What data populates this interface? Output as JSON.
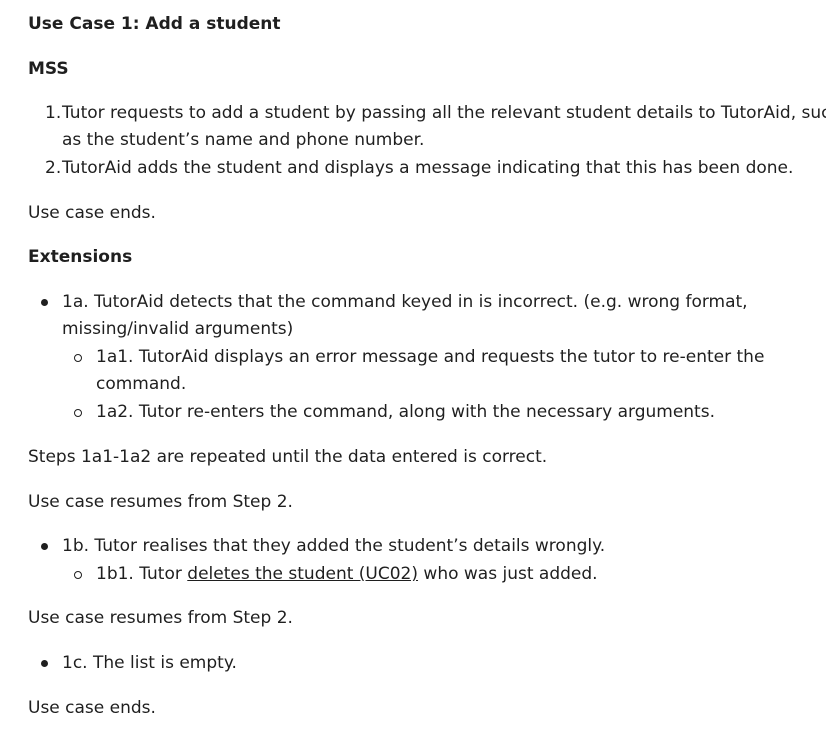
{
  "title": "Use Case 1: Add a student",
  "mss_heading": "MSS",
  "mss_steps": [
    {
      "num": "1.",
      "line1": "Tutor requests to add a student by passing all the relevant student details to TutorAid, such",
      "line2": "as the student’s name and phone number."
    },
    {
      "num": "2.",
      "line1": "TutorAid adds the student and displays a message indicating that this has been done."
    }
  ],
  "use_case_ends_1": "Use case ends.",
  "extensions_heading": "Extensions",
  "ext_1a": {
    "line1": "1a. TutorAid detects that the command keyed in is incorrect. (e.g. wrong format,",
    "line2": "missing/invalid arguments)",
    "sub": [
      {
        "line1": "1a1. TutorAid displays an error message and requests the tutor to re-enter the",
        "line2": "command."
      },
      {
        "line1": "1a2. Tutor re-enters the command, along with the necessary arguments."
      }
    ]
  },
  "steps_repeat": "Steps 1a1-1a2 are repeated until the data entered is correct.",
  "resumes_1": "Use case resumes from Step 2.",
  "ext_1b": {
    "line1": "1b. Tutor realises that they added the student’s details wrongly.",
    "sub_prefix": "1b1. Tutor ",
    "sub_link": "deletes the student (UC02)",
    "sub_suffix": " who was just added."
  },
  "resumes_2": "Use case resumes from Step 2.",
  "ext_1c": {
    "line1": "1c. The list is empty."
  },
  "use_case_ends_2": "Use case ends."
}
